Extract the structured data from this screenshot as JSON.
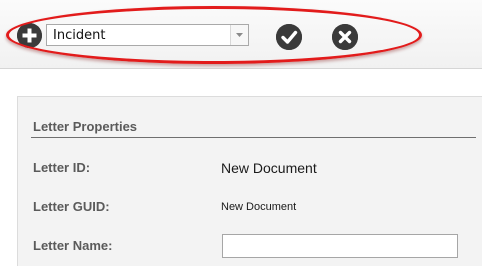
{
  "toolbar": {
    "add_icon": "plus-circle-icon",
    "type_select": {
      "value": "Incident"
    },
    "confirm_icon": "check-circle-icon",
    "cancel_icon": "x-circle-icon",
    "highlight_color": "#e21b1b"
  },
  "letter_properties": {
    "title": "Letter Properties",
    "fields": {
      "letter_id": {
        "label": "Letter ID:",
        "value": "New Document"
      },
      "letter_guid": {
        "label": "Letter GUID:",
        "value": "New Document"
      },
      "letter_name": {
        "label": "Letter Name:",
        "value": "",
        "placeholder": ""
      }
    }
  }
}
